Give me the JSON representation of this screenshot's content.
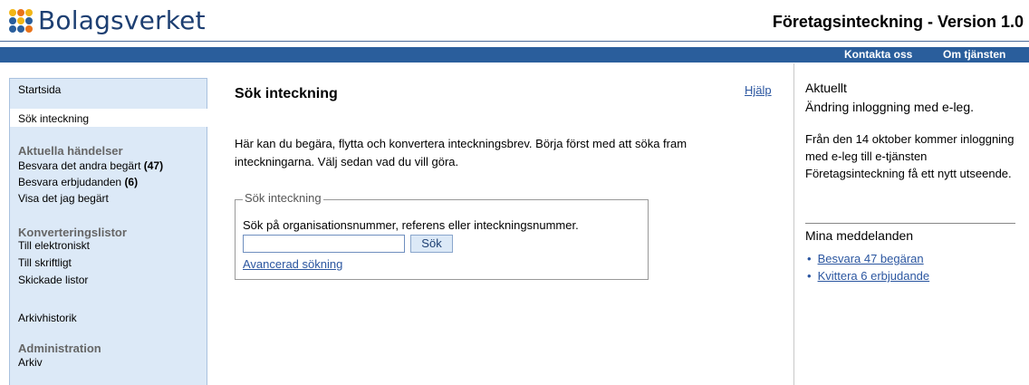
{
  "header": {
    "logo_text": "Bolagsverket",
    "app_title": "Företagsinteckning - Version 1.0"
  },
  "topnav": {
    "contact": "Kontakta oss",
    "about": "Om tjänsten"
  },
  "sidebar": {
    "home": "Startsida",
    "search": "Sök inteckning",
    "events_heading": "Aktuella händelser",
    "answer_requests": "Besvara det andra begärt",
    "answer_requests_count": "(47)",
    "answer_offers": "Besvara erbjudanden",
    "answer_offers_count": "(6)",
    "my_requests": "Visa det jag begärt",
    "conversion_heading": "Konverteringslistor",
    "to_electronic": "Till elektroniskt",
    "to_written": "Till skriftligt",
    "sent_lists": "Skickade listor",
    "archive_history": "Arkivhistorik",
    "admin_heading": "Administration",
    "archive": "Arkiv"
  },
  "main": {
    "title": "Sök inteckning",
    "help": "Hjälp",
    "intro": "Här kan du begära, flytta och konvertera inteckningsbrev. Börja först med att söka fram inteckningarna. Välj sedan vad du vill göra.",
    "fieldset_legend": "Sök inteckning",
    "search_description": "Sök på organisationsnummer, referens eller inteckningsnummer.",
    "search_value": "",
    "search_button": "Sök",
    "advanced_link": "Avancerad sökning"
  },
  "right": {
    "current_heading": "Aktuellt",
    "news_title": "Ändring inloggning med e-leg.",
    "news_body": "Från den 14 oktober kommer inloggning med e-leg till e-tjänsten Företagsinteckning få ett nytt utseende.",
    "messages_heading": "Mina meddelanden",
    "messages": [
      "Besvara 47 begäran",
      "Kvittera 6 erbjudande"
    ]
  },
  "colors": {
    "brand": "#1d3f72",
    "bar": "#2a5e9c",
    "sidebar_bg": "#dce9f7",
    "link": "#2b56a0"
  }
}
